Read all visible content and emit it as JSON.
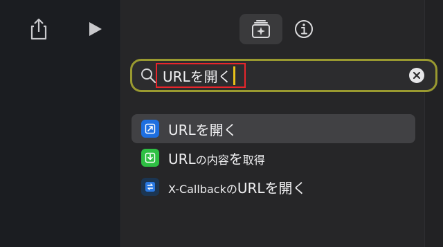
{
  "colors": {
    "search_border": "#9a9a30",
    "highlight_border": "#e8252b",
    "caret": "#e8c21a",
    "blue_icon": "#1e6fe0",
    "green_icon": "#2ebf43",
    "dark_blue_icon": "#1b3552"
  },
  "toolbar": {
    "share_icon": "share-icon",
    "play_icon": "play-icon"
  },
  "tabs": {
    "gallery_icon": "sparkle-gallery-icon",
    "info_icon": "info-icon"
  },
  "search": {
    "value": "URLを開く",
    "icon": "search-icon",
    "clear_icon": "clear-icon"
  },
  "results": [
    {
      "label": "URLを開く",
      "icon": "open-url-icon",
      "selected": true
    },
    {
      "label_parts": [
        "URL",
        "の内容",
        "を",
        "取得"
      ],
      "icon": "get-contents-icon",
      "selected": false
    },
    {
      "label_parts": [
        "X-Callback",
        "の",
        "URLを開く"
      ],
      "icon": "x-callback-icon",
      "selected": false
    }
  ]
}
